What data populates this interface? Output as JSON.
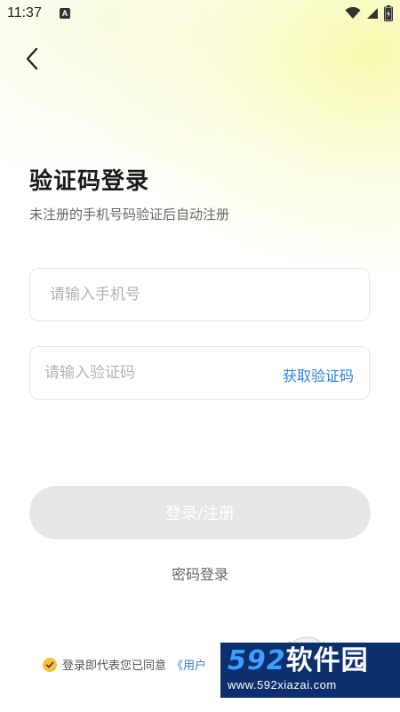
{
  "status_bar": {
    "time": "11:37",
    "notification_badge": "A",
    "icons": [
      "wifi-icon",
      "signal-icon",
      "battery-icon"
    ]
  },
  "header": {
    "back_icon": "chevron-left-icon"
  },
  "main": {
    "title": "验证码登录",
    "subtitle": "未注册的手机号码验证后自动注册",
    "phone_input": {
      "placeholder": "请输入手机号",
      "value": ""
    },
    "code_input": {
      "placeholder": "请输入验证码",
      "value": ""
    },
    "get_code_label": "获取验证码",
    "login_button_label": "登录/注册",
    "password_login_label": "密码登录"
  },
  "agreement": {
    "checked": true,
    "text": "登录即代表您已同意",
    "link_text": "《用户"
  },
  "watermark": {
    "number": "592",
    "name": "软件园",
    "url": "www.592xiazai.com"
  },
  "colors": {
    "accent_blue": "#2f7fe0",
    "checkbox_yellow": "#f7c23a",
    "disabled_button": "#e6e6e6",
    "watermark_bg": "#0d2f6e"
  }
}
